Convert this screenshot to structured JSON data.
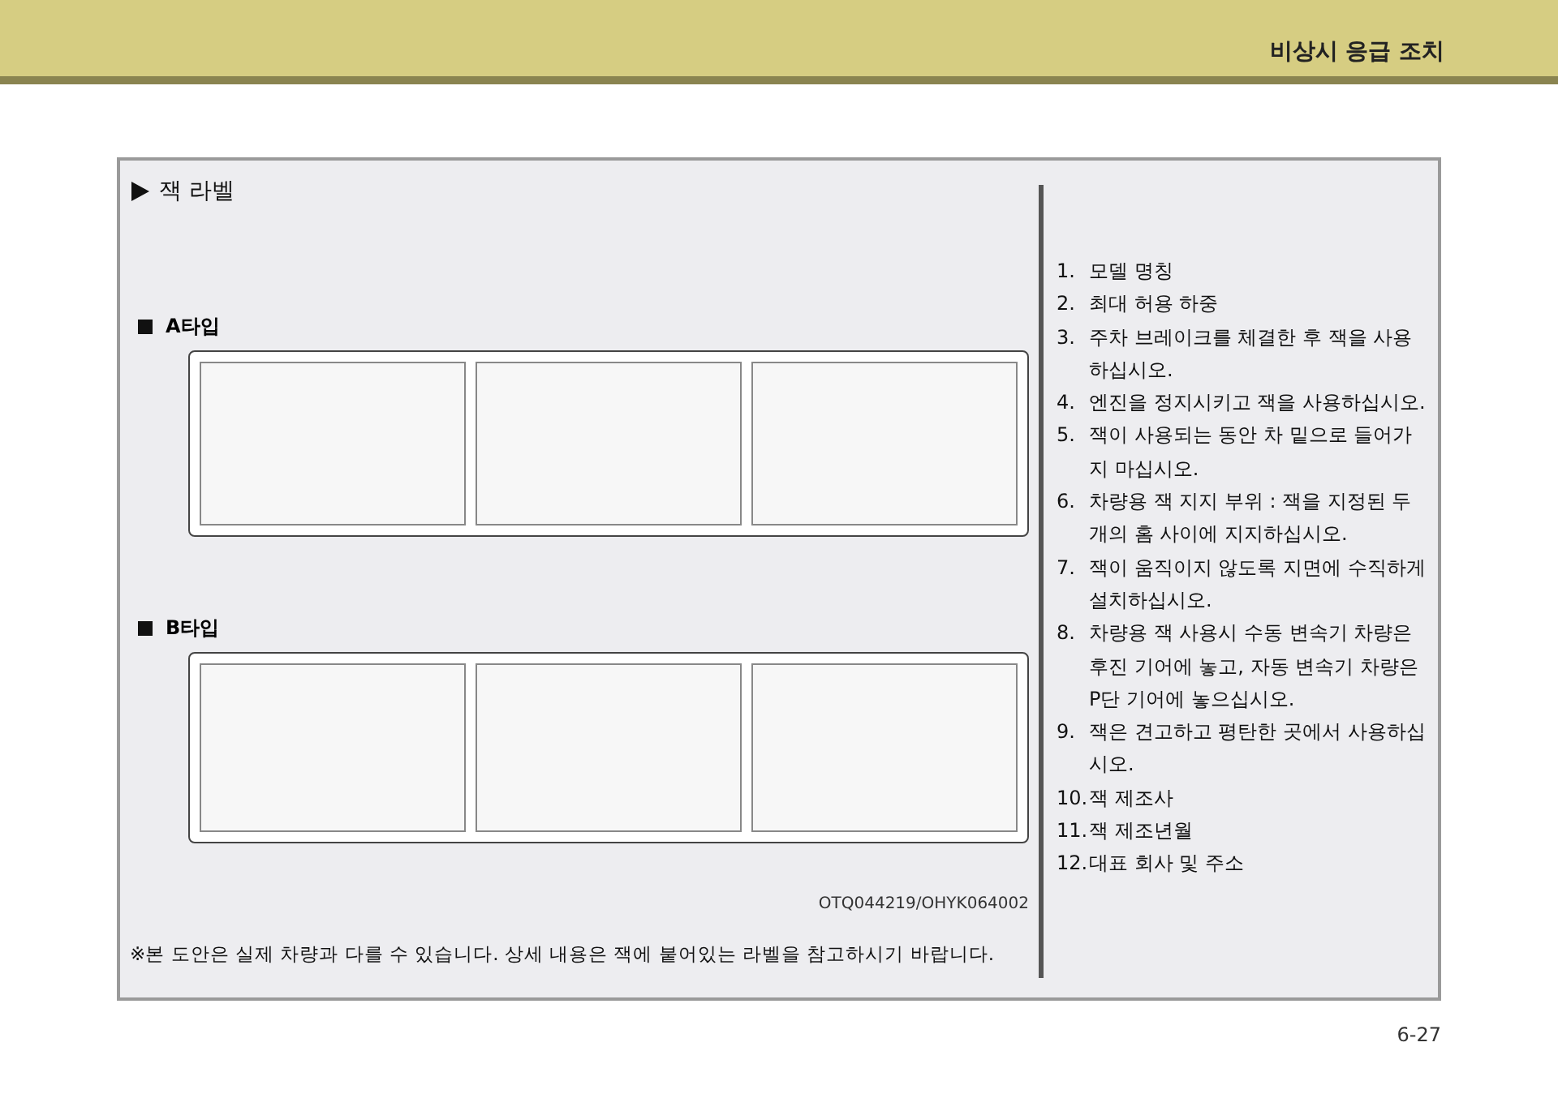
{
  "header": {
    "section_title": "비상시 응급 조치"
  },
  "section": {
    "title": "잭 라벨",
    "label_types": [
      {
        "title": "A타입"
      },
      {
        "title": "B타입"
      }
    ],
    "image_code": "OTQ044219/OHYK064002",
    "footnote": "※본 도안은 실제 차량과 다를 수 있습니다. 상세 내용은 잭에 붙어있는 라벨을 참고하시기 바랍니다."
  },
  "legend": [
    {
      "number": "1.",
      "text": "모델 명칭"
    },
    {
      "number": "2.",
      "text": "최대 허용 하중"
    },
    {
      "number": "3.",
      "text": "주차 브레이크를 체결한 후 잭을 사용하십시오."
    },
    {
      "number": "4.",
      "text": "엔진을 정지시키고 잭을 사용하십시오."
    },
    {
      "number": "5.",
      "text": "잭이 사용되는 동안 차 밑으로 들어가지 마십시오."
    },
    {
      "number": "6.",
      "text": "차량용 잭 지지 부위 : 잭을 지정된 두개의 홈 사이에 지지하십시오."
    },
    {
      "number": "7.",
      "text": "잭이 움직이지 않도록 지면에 수직하게 설치하십시오."
    },
    {
      "number": "8.",
      "text": "차량용 잭 사용시 수동 변속기 차량은 후진 기어에 놓고, 자동 변속기 차량은 P단 기어에 놓으십시오."
    },
    {
      "number": "9.",
      "text": "잭은 견고하고 평탄한 곳에서 사용하십시오."
    },
    {
      "number": "10.",
      "text": "잭 제조사"
    },
    {
      "number": "11.",
      "text": "잭 제조년월"
    },
    {
      "number": "12.",
      "text": "대표 회사 및 주소"
    }
  ],
  "page_number": "6-27"
}
